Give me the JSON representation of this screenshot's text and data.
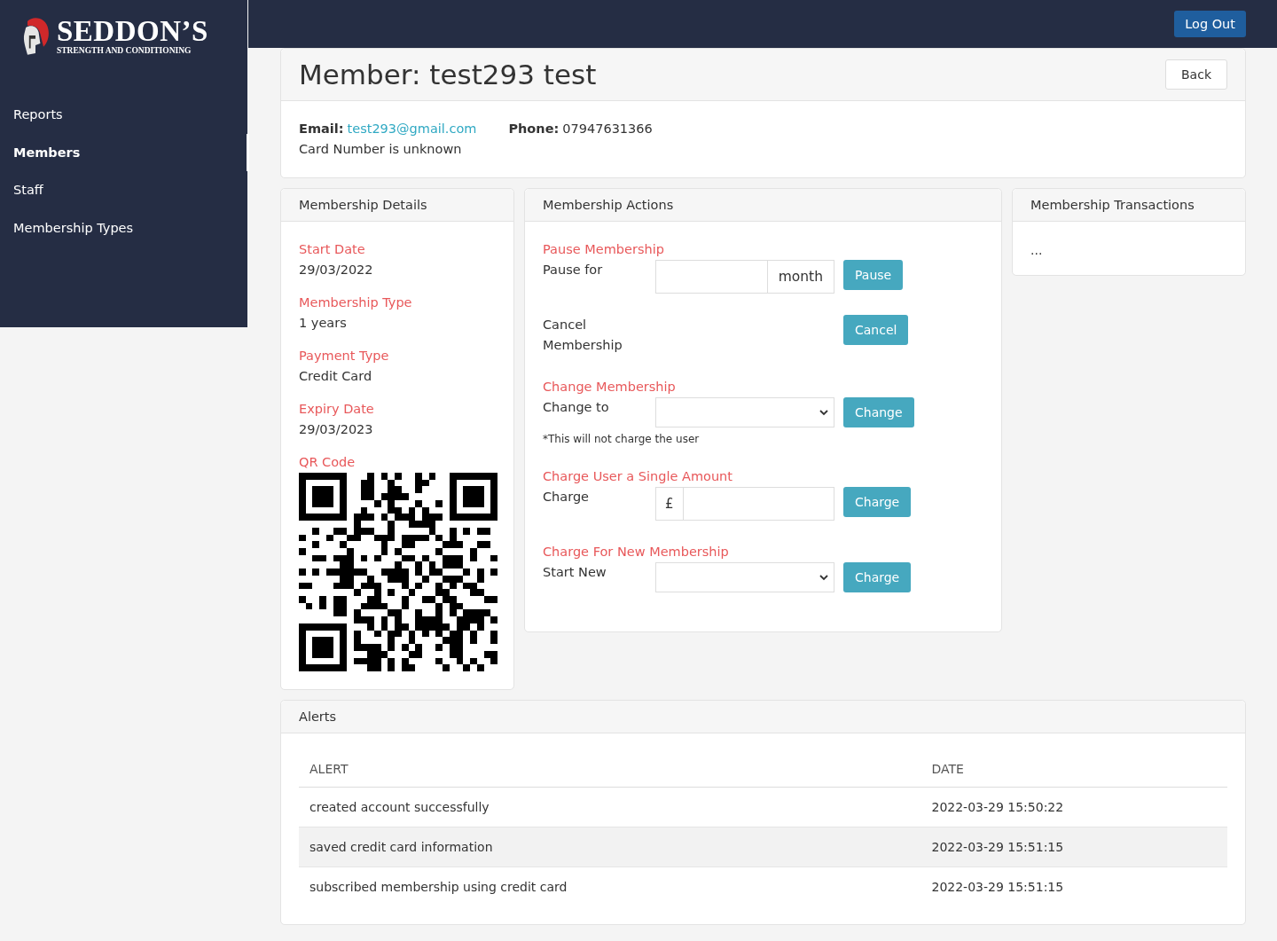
{
  "logo": {
    "title": "SEDDON’S",
    "subtitle": "STRENGTH AND CONDITIONING"
  },
  "sidebar": {
    "items": [
      {
        "label": "Reports",
        "selected": false
      },
      {
        "label": "Members",
        "selected": true
      },
      {
        "label": "Staff",
        "selected": false
      },
      {
        "label": "Membership Types",
        "selected": false
      }
    ]
  },
  "topbar": {
    "logout": "Log Out"
  },
  "member": {
    "title": "Member: test293 test",
    "back": "Back",
    "email_label": "Email:",
    "email": "test293@gmail.com",
    "phone_label": "Phone:",
    "phone": "07947631366",
    "card": "Card Number is unknown"
  },
  "details": {
    "title": "Membership Details",
    "fields": [
      {
        "label": "Start Date",
        "value": "29/03/2022"
      },
      {
        "label": "Membership Type",
        "value": "1 years"
      },
      {
        "label": "Payment Type",
        "value": "Credit Card"
      },
      {
        "label": "Expiry Date",
        "value": "29/03/2023"
      }
    ],
    "qr_label": "QR Code"
  },
  "actions": {
    "title": "Membership Actions",
    "items": [
      {
        "kind": "addon",
        "heading": "Pause Membership",
        "label": "Pause for",
        "addon": "month",
        "button": "Pause"
      },
      {
        "kind": "plain",
        "label": "Cancel Membership",
        "button": "Cancel"
      },
      {
        "kind": "select",
        "heading": "Change Membership",
        "label": "Change to",
        "button": "Change",
        "note": "*This will not charge the user"
      },
      {
        "kind": "currency",
        "heading": "Charge User a Single Amount",
        "label": "Charge",
        "prefix": "£",
        "button": "Charge"
      },
      {
        "kind": "select",
        "heading": "Charge For New Membership",
        "label": "Start New",
        "button": "Charge"
      }
    ]
  },
  "transactions": {
    "title": "Membership Transactions",
    "body": "..."
  },
  "alerts": {
    "title": "Alerts",
    "columns": [
      "ALERT",
      "DATE"
    ],
    "rows": [
      [
        "created account successfully",
        "2022-03-29 15:50:22"
      ],
      [
        "saved credit card information",
        "2022-03-29 15:51:15"
      ],
      [
        "subscribed membership using credit card",
        "2022-03-29 15:51:15"
      ]
    ]
  }
}
